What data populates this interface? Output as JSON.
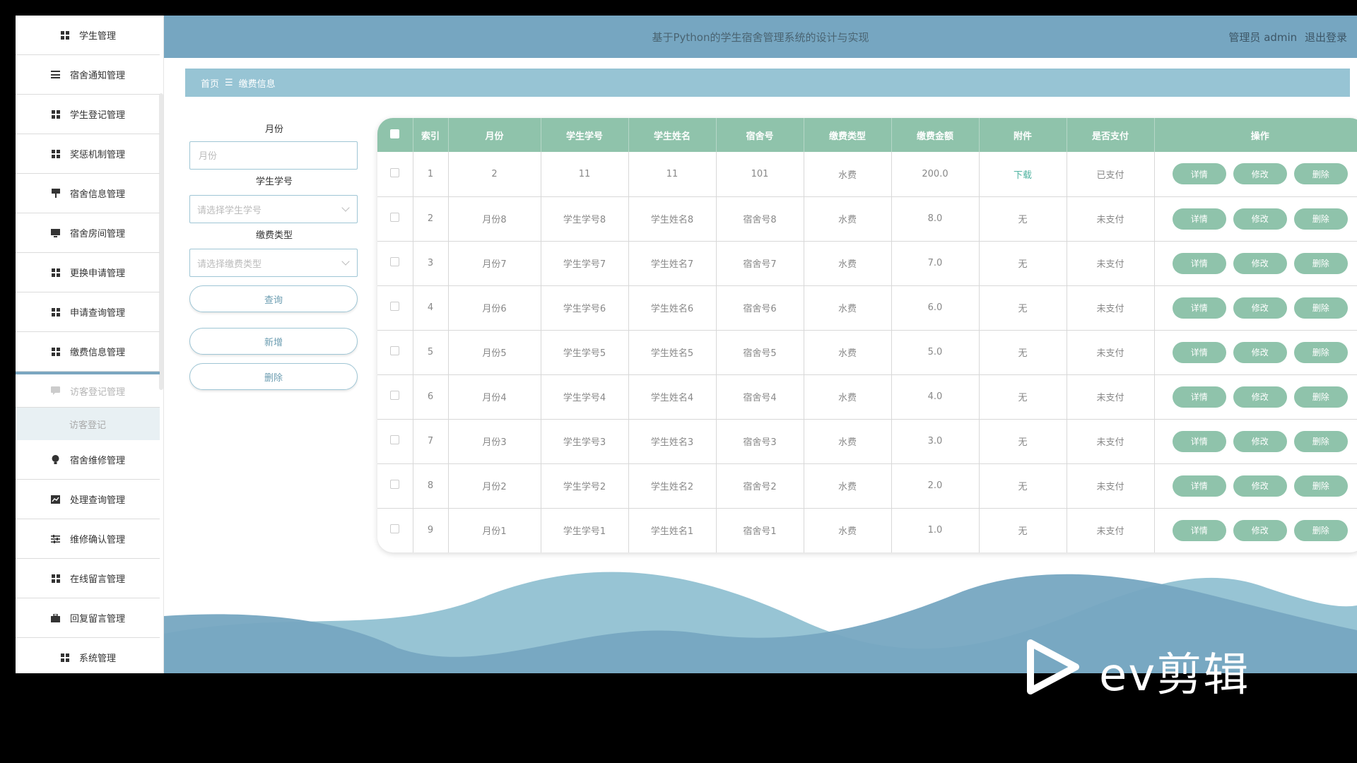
{
  "header": {
    "title": "基于Python的学生宿舍管理系统的设计与实现",
    "user_label": "管理员 admin",
    "logout": "退出登录"
  },
  "sidebar": {
    "items": [
      {
        "label": "学生管理",
        "icon": "grid-icon"
      },
      {
        "label": "宿舍通知管理",
        "icon": "list-icon"
      },
      {
        "label": "学生登记管理",
        "icon": "grid-icon"
      },
      {
        "label": "奖惩机制管理",
        "icon": "grid-icon"
      },
      {
        "label": "宿舍信息管理",
        "icon": "flag-icon"
      },
      {
        "label": "宿舍房间管理",
        "icon": "monitor-icon"
      },
      {
        "label": "更换申请管理",
        "icon": "grid-icon"
      },
      {
        "label": "申请查询管理",
        "icon": "grid-icon"
      },
      {
        "label": "缴费信息管理",
        "icon": "grid-icon"
      },
      {
        "label": "访客登记管理",
        "icon": "chat-icon"
      },
      {
        "label": "宿舍维修管理",
        "icon": "bulb-icon"
      },
      {
        "label": "处理查询管理",
        "icon": "chart-icon"
      },
      {
        "label": "维修确认管理",
        "icon": "sliders-icon"
      },
      {
        "label": "在线留言管理",
        "icon": "grid-icon"
      },
      {
        "label": "回复留言管理",
        "icon": "briefcase-icon"
      },
      {
        "label": "系统管理",
        "icon": "grid-icon"
      }
    ],
    "sub_item": "访客登记"
  },
  "breadcrumb": {
    "home": "首页",
    "sep": "☰",
    "current": "缴费信息"
  },
  "filters": {
    "month_label": "月份",
    "month_placeholder": "月份",
    "student_no_label": "学生学号",
    "student_no_placeholder": "请选择学生学号",
    "fee_type_label": "缴费类型",
    "fee_type_placeholder": "请选择缴费类型",
    "query_btn": "查询",
    "add_btn": "新增",
    "delete_btn": "删除"
  },
  "table": {
    "headers": [
      "索引",
      "月份",
      "学生学号",
      "学生姓名",
      "宿舍号",
      "缴费类型",
      "缴费金额",
      "附件",
      "是否支付",
      "操作"
    ],
    "rows": [
      [
        "1",
        "2",
        "11",
        "11",
        "101",
        "水费",
        "200.0",
        "下载",
        "已支付"
      ],
      [
        "2",
        "月份8",
        "学生学号8",
        "学生姓名8",
        "宿舍号8",
        "水费",
        "8.0",
        "无",
        "未支付"
      ],
      [
        "3",
        "月份7",
        "学生学号7",
        "学生姓名7",
        "宿舍号7",
        "水费",
        "7.0",
        "无",
        "未支付"
      ],
      [
        "4",
        "月份6",
        "学生学号6",
        "学生姓名6",
        "宿舍号6",
        "水费",
        "6.0",
        "无",
        "未支付"
      ],
      [
        "5",
        "月份5",
        "学生学号5",
        "学生姓名5",
        "宿舍号5",
        "水费",
        "5.0",
        "无",
        "未支付"
      ],
      [
        "6",
        "月份4",
        "学生学号4",
        "学生姓名4",
        "宿舍号4",
        "水费",
        "4.0",
        "无",
        "未支付"
      ],
      [
        "7",
        "月份3",
        "学生学号3",
        "学生姓名3",
        "宿舍号3",
        "水费",
        "3.0",
        "无",
        "未支付"
      ],
      [
        "8",
        "月份2",
        "学生学号2",
        "学生姓名2",
        "宿舍号2",
        "水费",
        "2.0",
        "无",
        "未支付"
      ],
      [
        "9",
        "月份1",
        "学生学号1",
        "学生姓名1",
        "宿舍号1",
        "水费",
        "1.0",
        "无",
        "未支付"
      ]
    ],
    "actions": [
      "详情",
      "修改",
      "删除"
    ]
  },
  "watermark": {
    "text": "ev剪辑"
  },
  "colors": {
    "header": "#76a6c1",
    "breadcrumb": "#97c4d4",
    "table_header": "#8fc3ab",
    "action_button": "#8fc3ab"
  }
}
